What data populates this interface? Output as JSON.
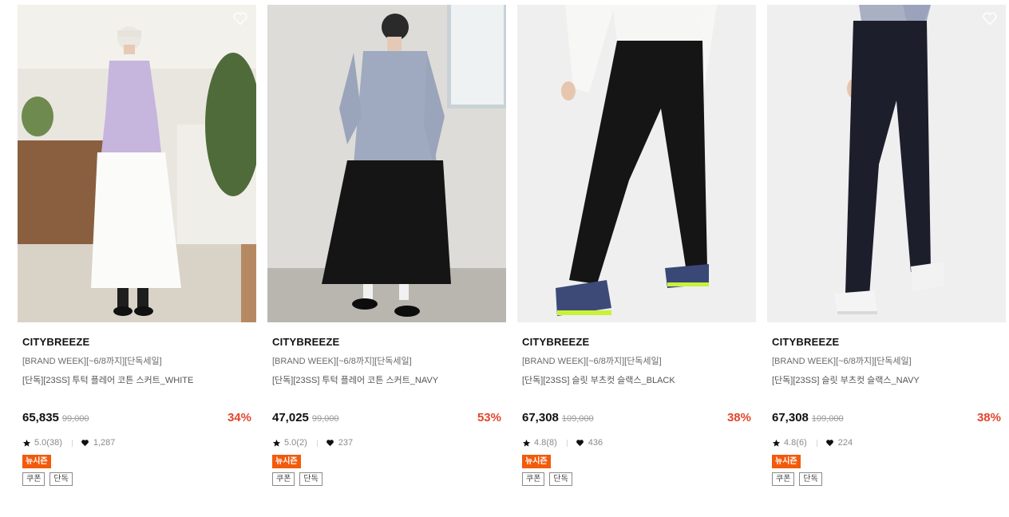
{
  "products": [
    {
      "brand": "CITYBREEZE",
      "promo": "[BRAND WEEK][~6/8까지][단독세일]",
      "name": "[단독][23SS] 투턱 플레어 코튼 스커트_WHITE",
      "price": "65,835",
      "original_price": "99,000",
      "discount": "34%",
      "rating": "5.0(38)",
      "likes": "1,287",
      "badge": "뉴시즌",
      "tags": [
        "쿠폰",
        "단독"
      ],
      "heart_visible": true
    },
    {
      "brand": "CITYBREEZE",
      "promo": "[BRAND WEEK][~6/8까지][단독세일]",
      "name": "[단독][23SS] 투턱 플레어 코튼 스커트_NAVY",
      "price": "47,025",
      "original_price": "99,000",
      "discount": "53%",
      "rating": "5.0(2)",
      "likes": "237",
      "badge": "뉴시즌",
      "tags": [
        "쿠폰",
        "단독"
      ],
      "heart_visible": false
    },
    {
      "brand": "CITYBREEZE",
      "promo": "[BRAND WEEK][~6/8까지][단독세일]",
      "name": "[단독][23SS] 슬릿 부츠컷 슬랙스_BLACK",
      "price": "67,308",
      "original_price": "109,000",
      "discount": "38%",
      "rating": "4.8(8)",
      "likes": "436",
      "badge": "뉴시즌",
      "tags": [
        "쿠폰",
        "단독"
      ],
      "heart_visible": false
    },
    {
      "brand": "CITYBREEZE",
      "promo": "[BRAND WEEK][~6/8까지][단독세일]",
      "name": "[단독][23SS] 슬릿 부츠컷 슬랙스_NAVY",
      "price": "67,308",
      "original_price": "109,000",
      "discount": "38%",
      "rating": "4.8(6)",
      "likes": "224",
      "badge": "뉴시즌",
      "tags": [
        "쿠폰",
        "단독"
      ],
      "heart_visible": true
    }
  ],
  "colors": {
    "discount": "#e3452d",
    "badge_bg": "#f25a0c",
    "text_muted": "#8a8a8a"
  },
  "icons": {
    "wishlist": "heart-outline-icon",
    "rating": "star-icon",
    "likes": "heart-filled-icon"
  }
}
